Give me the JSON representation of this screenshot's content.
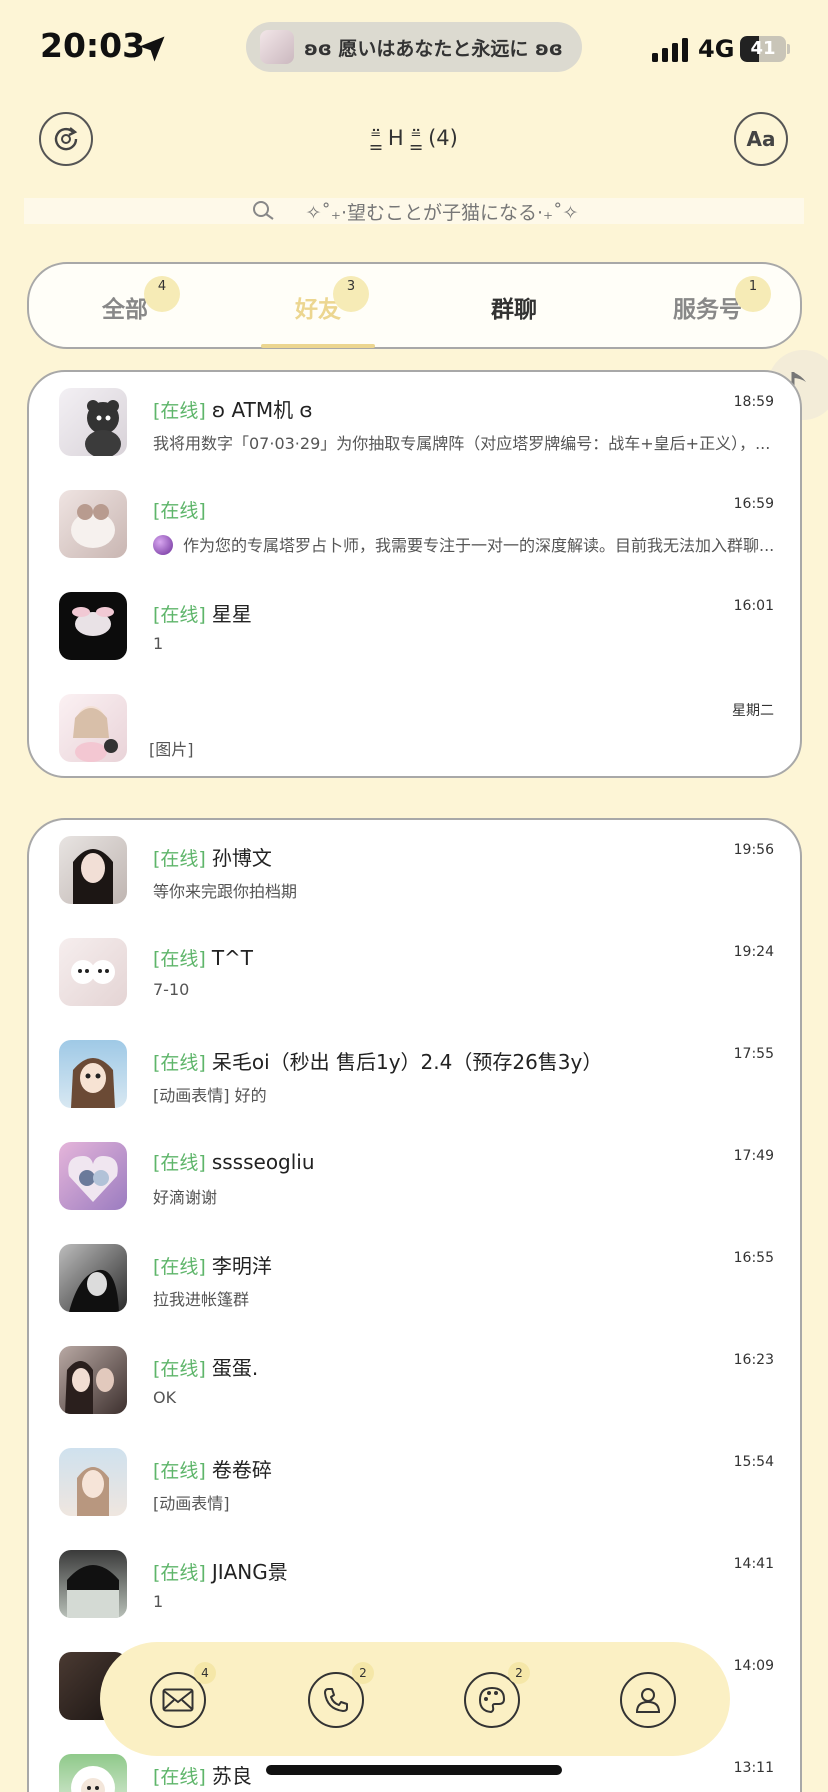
{
  "status_bar": {
    "time": "20:03",
    "island_text": "ʚɞ 愿いはあなたと永远に ʚɞ",
    "network": "4G",
    "battery": "41",
    "battery_level": 0.41
  },
  "header": {
    "title": "⁼̳̈ ᕼ ⁼̳̈ (4)"
  },
  "search": {
    "placeholder": "✧˚₊‧望むことが子猫になる‧₊˚✧"
  },
  "tabs": [
    {
      "label": "全部",
      "badge": "4"
    },
    {
      "label": "好友",
      "badge": "3"
    },
    {
      "label": "群聊",
      "badge": ""
    },
    {
      "label": "服务号",
      "badge": "1"
    }
  ],
  "chats_top": [
    {
      "online": "[在线]",
      "name": "ʚ ATM机 ɞ",
      "preview": "我将用数字「07·03·29」为你抽取专属牌阵（对应塔罗牌编号：战车+皇后+正义），...",
      "time": "18:59"
    },
    {
      "online": "[在线]",
      "name": "",
      "preview": "作为您的专属塔罗占卜师，我需要专注于一对一的深度解读。目前我无法加入群聊...",
      "time": "16:59"
    },
    {
      "online": "[在线]",
      "name": "星星",
      "preview": "1",
      "time": "16:01"
    },
    {
      "online": "",
      "name": "",
      "preview": "[图片]",
      "time": "星期二"
    }
  ],
  "chats_main": [
    {
      "online": "[在线]",
      "name": "孙博文",
      "preview": "等你来完跟你拍档期",
      "time": "19:56"
    },
    {
      "online": "[在线]",
      "name": "T^T",
      "preview": "7-10",
      "time": "19:24"
    },
    {
      "online": "[在线]",
      "name": "呆毛oi（秒出 售后1y）2.4（预存26售3y）",
      "preview": "[动画表情] 好的",
      "time": "17:55"
    },
    {
      "online": "[在线]",
      "name": "sssseogliu",
      "preview": "好滴谢谢",
      "time": "17:49"
    },
    {
      "online": "[在线]",
      "name": "李明洋",
      "preview": "拉我进帐篷群",
      "time": "16:55"
    },
    {
      "online": "[在线]",
      "name": "蛋蛋.",
      "preview": "OK",
      "time": "16:23"
    },
    {
      "online": "[在线]",
      "name": "卷卷碎",
      "preview": "[动画表情]",
      "time": "15:54"
    },
    {
      "online": "[在线]",
      "name": "JIANG景",
      "preview": "1",
      "time": "14:41"
    },
    {
      "online": "",
      "name": "",
      "preview": "",
      "time": "14:09"
    },
    {
      "online": "[在线]",
      "name": "苏良",
      "preview": "",
      "time": "13:11"
    }
  ],
  "bottom_nav": {
    "messages_badge": "4",
    "calls_badge": "2",
    "theme_badge": "2"
  }
}
